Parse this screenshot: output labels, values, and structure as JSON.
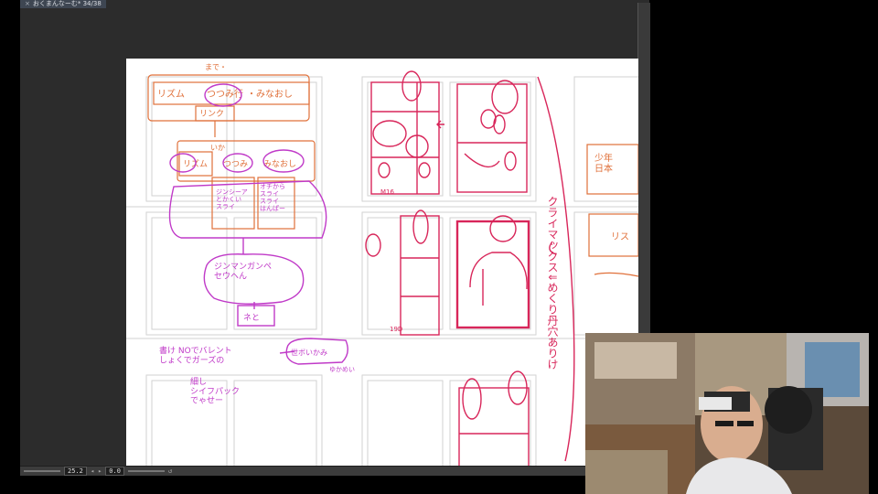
{
  "window": {
    "tab_title": "おくまんなーむ* 34/38",
    "close_glyph": "×"
  },
  "statusbar": {
    "zoom": "25.2",
    "rotation": "0.0",
    "prev_icon": "◂",
    "next_icon": "▸",
    "reset_icon": "↺"
  },
  "sketch": {
    "chain_top_above": "まで・",
    "chain_top_1": "リズム",
    "chain_top_2": "つつみ行",
    "chain_top_3": "・みなおし",
    "chain_top_rinku": "リンク",
    "chain_mid_above": "いか",
    "chain_mid_1": "リズム",
    "chain_mid_2": "つつみ",
    "chain_mid_3": "みなおし",
    "purple_box_1": "ジンシーア\nとかくい\nスライ",
    "purple_box_2": "オチから\nスライ\nスライ\nはんぱー",
    "bubble": "ジンマンガンペ\nセウヘん",
    "bottom_box": "ネと",
    "note_left": "書け NOでバレント\nしょくでガーズの",
    "note_box": "世ボいかみ",
    "note_small": "ゆかめい",
    "note_lower": "細し\nシイフパック\nでゃせー",
    "right_vertical": "クライマックス⇓めくり丹穴ありけ",
    "page_mark_1": "M16",
    "page_mark_2": "19D",
    "far_right_1": "少年\n日本",
    "far_right_2": "リス"
  },
  "icons": {
    "webcam": "webcam-feed"
  }
}
